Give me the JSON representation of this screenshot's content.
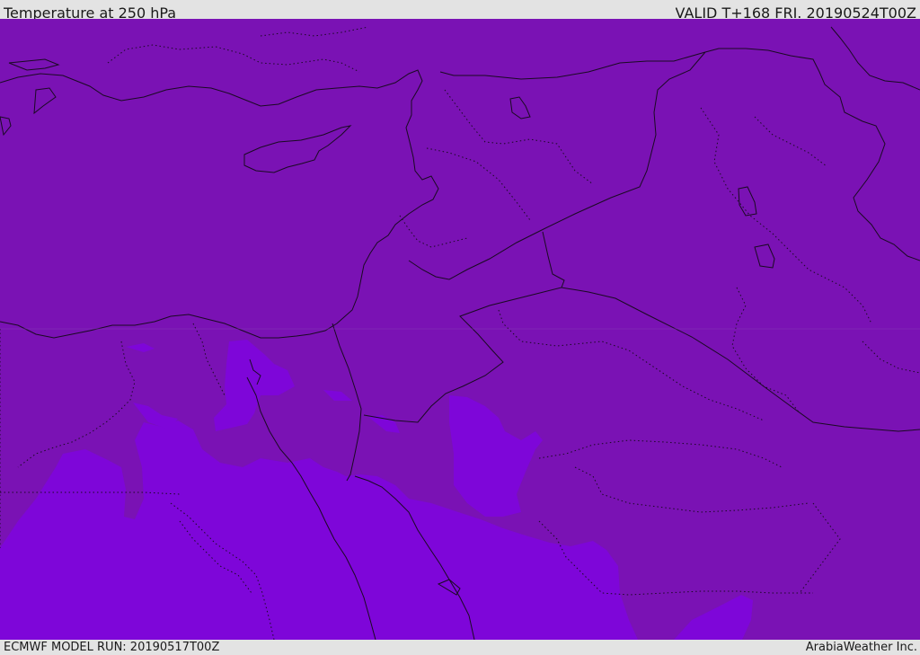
{
  "header": {
    "title": "Temperature at 250 hPa",
    "valid_time": "VALID T+168 FRI. 20190524T00Z"
  },
  "footer": {
    "model_run": "ECMWF MODEL RUN: 20190517T00Z",
    "credit": "ArabiaWeather Inc."
  },
  "colors": {
    "dominant_fill": "#7a12b4",
    "secondary_fill": "#7e06d9",
    "boundary": "#1a0a22",
    "bar_background": "#e3e3e3"
  }
}
